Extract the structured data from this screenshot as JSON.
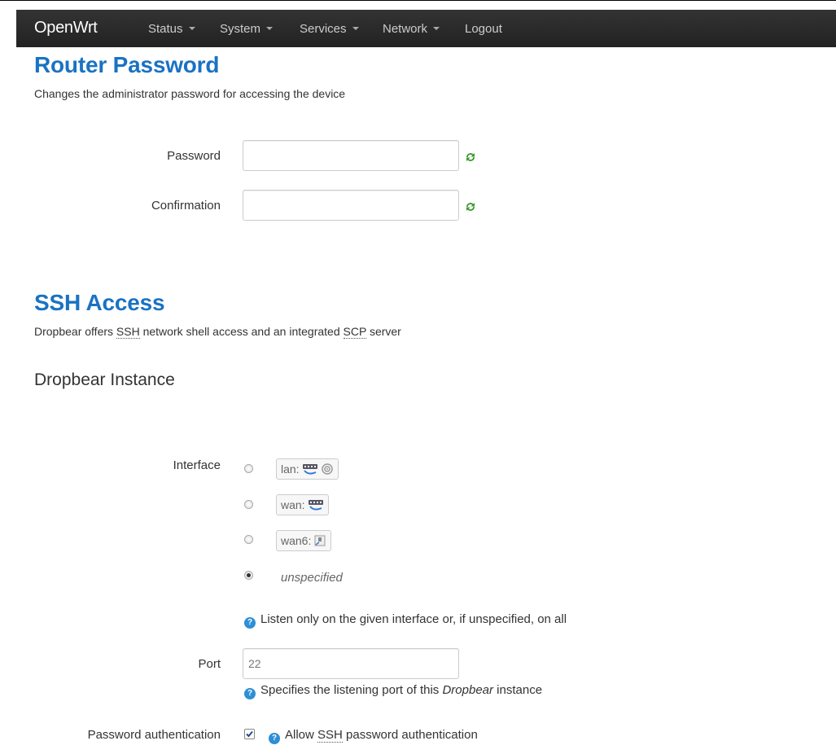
{
  "nav": {
    "brand": "OpenWrt",
    "items": [
      {
        "label": "Status",
        "dropdown": true
      },
      {
        "label": "System",
        "dropdown": true
      },
      {
        "label": "Services",
        "dropdown": true
      },
      {
        "label": "Network",
        "dropdown": true
      },
      {
        "label": "Logout",
        "dropdown": false
      }
    ]
  },
  "router_password": {
    "title": "Router Password",
    "description": "Changes the administrator password for accessing the device",
    "password_label": "Password",
    "password_value": "",
    "confirmation_label": "Confirmation",
    "confirmation_value": "",
    "reveal_icon": "reload-icon"
  },
  "ssh": {
    "title": "SSH Access",
    "desc_prefix": "Dropbear offers ",
    "abbr_ssh": "SSH",
    "desc_mid": " network shell access and an integrated ",
    "abbr_scp": "SCP",
    "desc_suffix": " server",
    "instance_title": "Dropbear Instance",
    "interface_label": "Interface",
    "interfaces": [
      {
        "name": "lan:",
        "checked": false,
        "icons": [
          "ethernet-switch-icon",
          "wifi-icon"
        ]
      },
      {
        "name": "wan:",
        "checked": false,
        "icons": [
          "ethernet-switch-icon"
        ]
      },
      {
        "name": "wan6:",
        "checked": false,
        "icons": [
          "network-port-icon"
        ]
      }
    ],
    "unspecified_label": "unspecified",
    "unspecified_checked": true,
    "interface_help": "Listen only on the given interface or, if unspecified, on all",
    "port_label": "Port",
    "port_value": "22",
    "port_help_prefix": "Specifies the listening port of this ",
    "port_help_em": "Dropbear",
    "port_help_suffix": " instance",
    "password_auth_label": "Password authentication",
    "password_auth_checked": true,
    "password_auth_help_prefix": "Allow ",
    "password_auth_help_abbr": "SSH",
    "password_auth_help_suffix": " password authentication"
  },
  "colors": {
    "heading": "#1a72c3",
    "navbar": "#222222",
    "help_icon": "#2d8fd5",
    "reveal_icon": "#3c9a2e"
  }
}
